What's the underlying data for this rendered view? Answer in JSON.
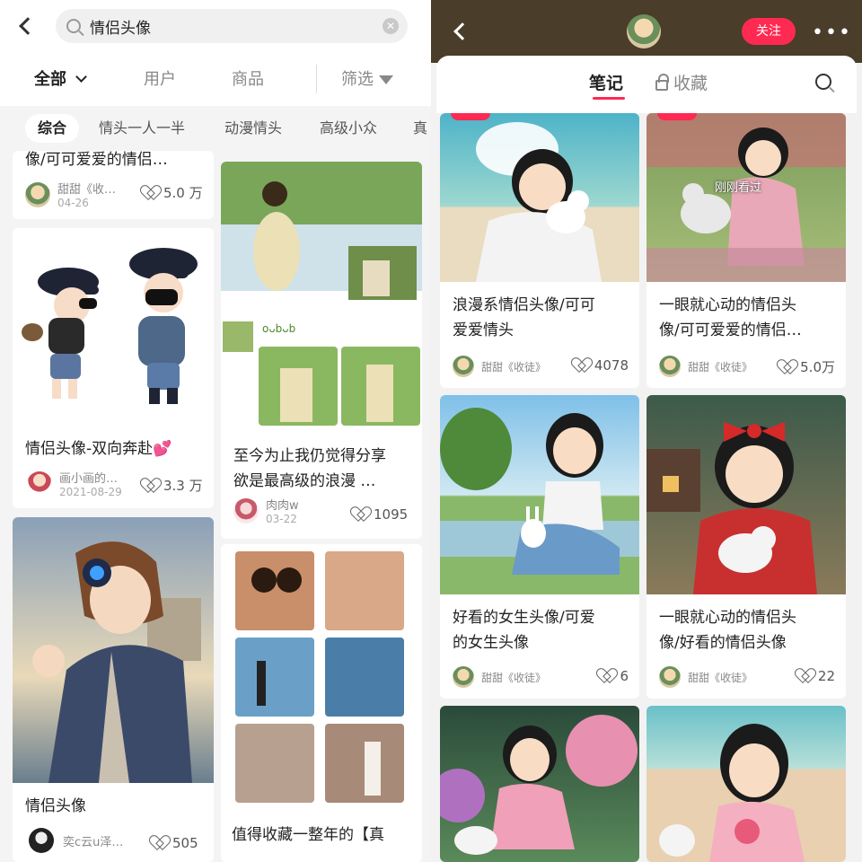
{
  "left": {
    "search": {
      "value": "情侣头像",
      "clear_icon": "clear-icon"
    },
    "tabs": [
      {
        "label": "全部",
        "active": true
      },
      {
        "label": "用户"
      },
      {
        "label": "商品"
      },
      {
        "label": "筛选"
      }
    ],
    "chips": [
      {
        "label": "综合",
        "active": true
      },
      {
        "label": "情头一人一半"
      },
      {
        "label": "动漫情头"
      },
      {
        "label": "高级小众"
      },
      {
        "label": "真"
      }
    ],
    "cards": [
      {
        "title": "像/可可爱爱的情侣…",
        "author": "甜甜《收…",
        "date": "04-26",
        "likes": "5.0 万"
      },
      {
        "title": "情侣头像-双向奔赴💕",
        "author": "画小画的…",
        "date": "2021-08-29",
        "likes": "3.3 万"
      },
      {
        "title": "情侣头像",
        "author": "奕c云u泽…",
        "likes": "505"
      },
      {
        "title_line1": "至今为止我仍觉得分享",
        "title_line2": "欲是最高级的浪漫 …",
        "author": "肉肉w",
        "date": "03-22",
        "likes": "1095"
      },
      {
        "title": "值得收藏一整年的【真"
      }
    ],
    "inner_caption": "oᴗbᴗb"
  },
  "right": {
    "follow_label": "关注",
    "more_label": "•••",
    "tabs": {
      "notes": "笔记",
      "favorites": "收藏"
    },
    "cards": [
      {
        "title_line1": "浪漫系情侣头像/可可",
        "title_line2": "爱爱情头",
        "author": "甜甜《收徒》",
        "likes": "4078"
      },
      {
        "title_line1": "一眼就心动的情侣头",
        "title_line2": "像/可可爱爱的情侣…",
        "author": "甜甜《收徒》",
        "likes": "5.0万",
        "overlay": "刚刚看过"
      },
      {
        "title_line1": "好看的女生头像/可爱",
        "title_line2": "的女生头像",
        "author": "甜甜《收徒》",
        "likes": "6"
      },
      {
        "title_line1": "一眼就心动的情侣头",
        "title_line2": "像/好看的情侣头像",
        "author": "甜甜《收徒》",
        "likes": "22"
      }
    ]
  },
  "colors": {
    "accent": "#ff2a52",
    "topbar_right": "#4a3d2a"
  }
}
